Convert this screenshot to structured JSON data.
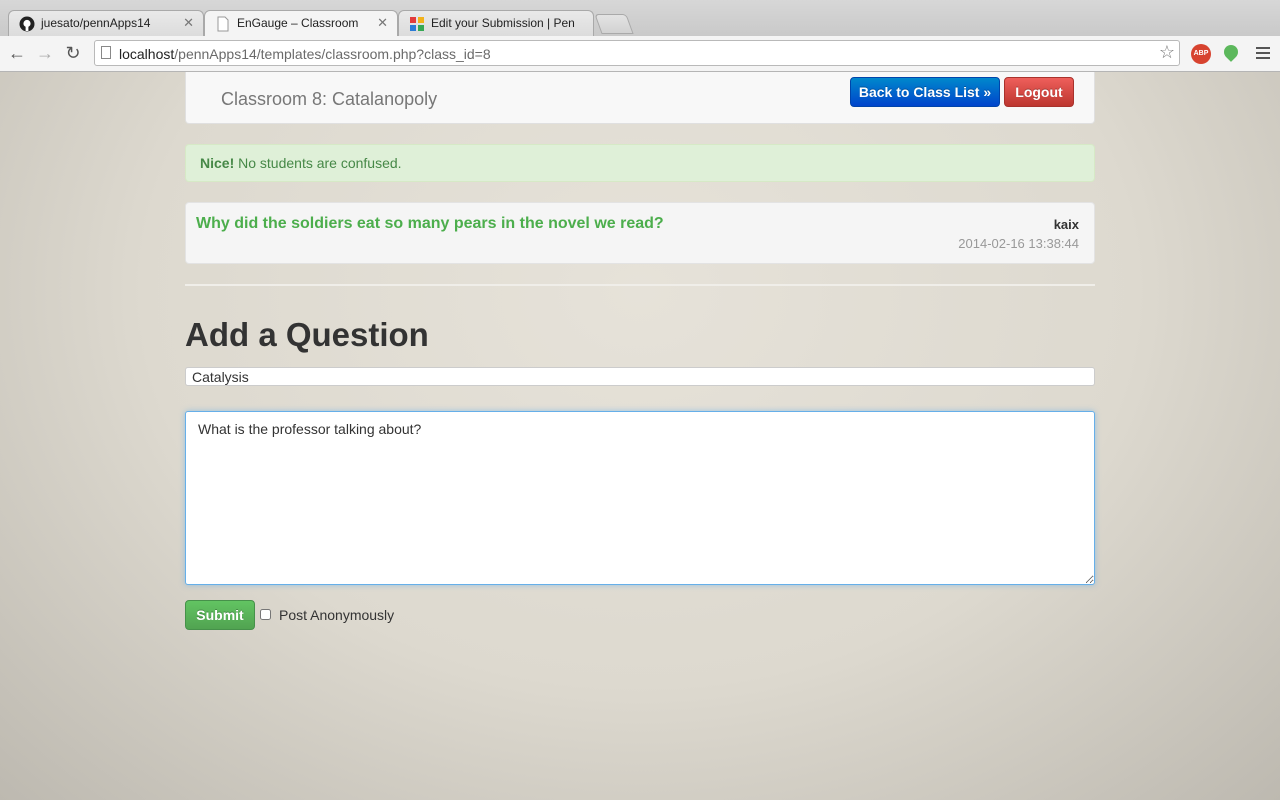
{
  "browser": {
    "tabs": [
      {
        "title": "juesato/pennApps14",
        "icon": "github-icon",
        "active": false
      },
      {
        "title": "EnGauge – Classroom",
        "icon": "page-icon",
        "active": true
      },
      {
        "title": "Edit your Submission | Pen",
        "icon": "pennapps-icon",
        "active": false
      }
    ],
    "url_host": "localhost",
    "url_path": "/pennApps14/templates/classroom.php?class_id=8",
    "extensions": {
      "abp_label": "ABP"
    }
  },
  "navbar": {
    "title": "Classroom 8: Catalanopoly",
    "back_label": "Back to Class List »",
    "logout_label": "Logout"
  },
  "alert": {
    "strong": "Nice!",
    "message": " No students are confused."
  },
  "questions": [
    {
      "text": "Why did the soldiers eat so many pears in the novel we read?",
      "user": "kaix",
      "timestamp": "2014-02-16 13:38:44"
    }
  ],
  "form": {
    "heading": "Add a Question",
    "subject_value": "Catalysis",
    "body_value": "What is the professor talking about?",
    "submit_label": "Submit",
    "anonymous_label": "Post Anonymously",
    "anonymous_checked": false
  },
  "colors": {
    "primary": "#0074cc",
    "danger": "#da4f49",
    "success": "#5bb75b",
    "question_text": "#4cae4c"
  }
}
